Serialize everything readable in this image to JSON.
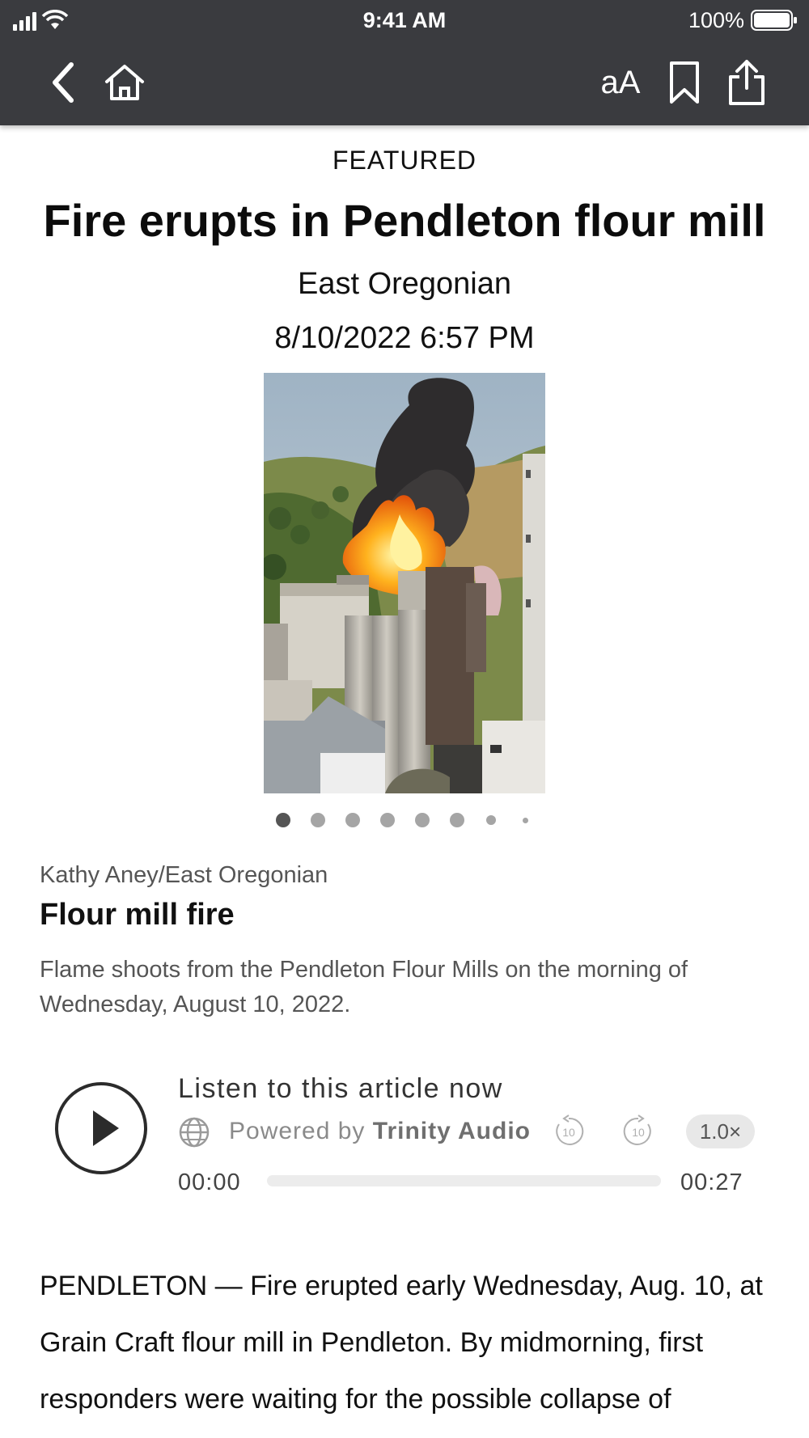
{
  "status_bar": {
    "time": "9:41 AM",
    "battery": "100%"
  },
  "nav": {
    "font_size_label": "aA"
  },
  "article": {
    "kicker": "FEATURED",
    "headline": "Fire erupts in Pendleton flour mill",
    "source": "East Oregonian",
    "date": "8/10/2022 6:57 PM",
    "photo_credit": "Kathy Aney/East Oregonian",
    "caption_title": "Flour mill fire",
    "caption_text": "Flame shoots from the Pendleton Flour Mills on the morning of Wednesday, August 10, 2022.",
    "gallery": {
      "slides": 8,
      "current": 1
    },
    "body": "PENDLETON — Fire erupted early Wednesday, Aug. 10, at Grain Craft flour mill in Pendleton. By midmorning, first responders were waiting for the possible collapse of"
  },
  "audio": {
    "title": "Listen to this article now",
    "powered_prefix": "Powered by",
    "powered_brand": "Trinity Audio",
    "skip_back_label": "10",
    "skip_forward_label": "10",
    "speed": "1.0×",
    "time_start": "00:00",
    "time_end": "00:27",
    "progress": 0
  }
}
